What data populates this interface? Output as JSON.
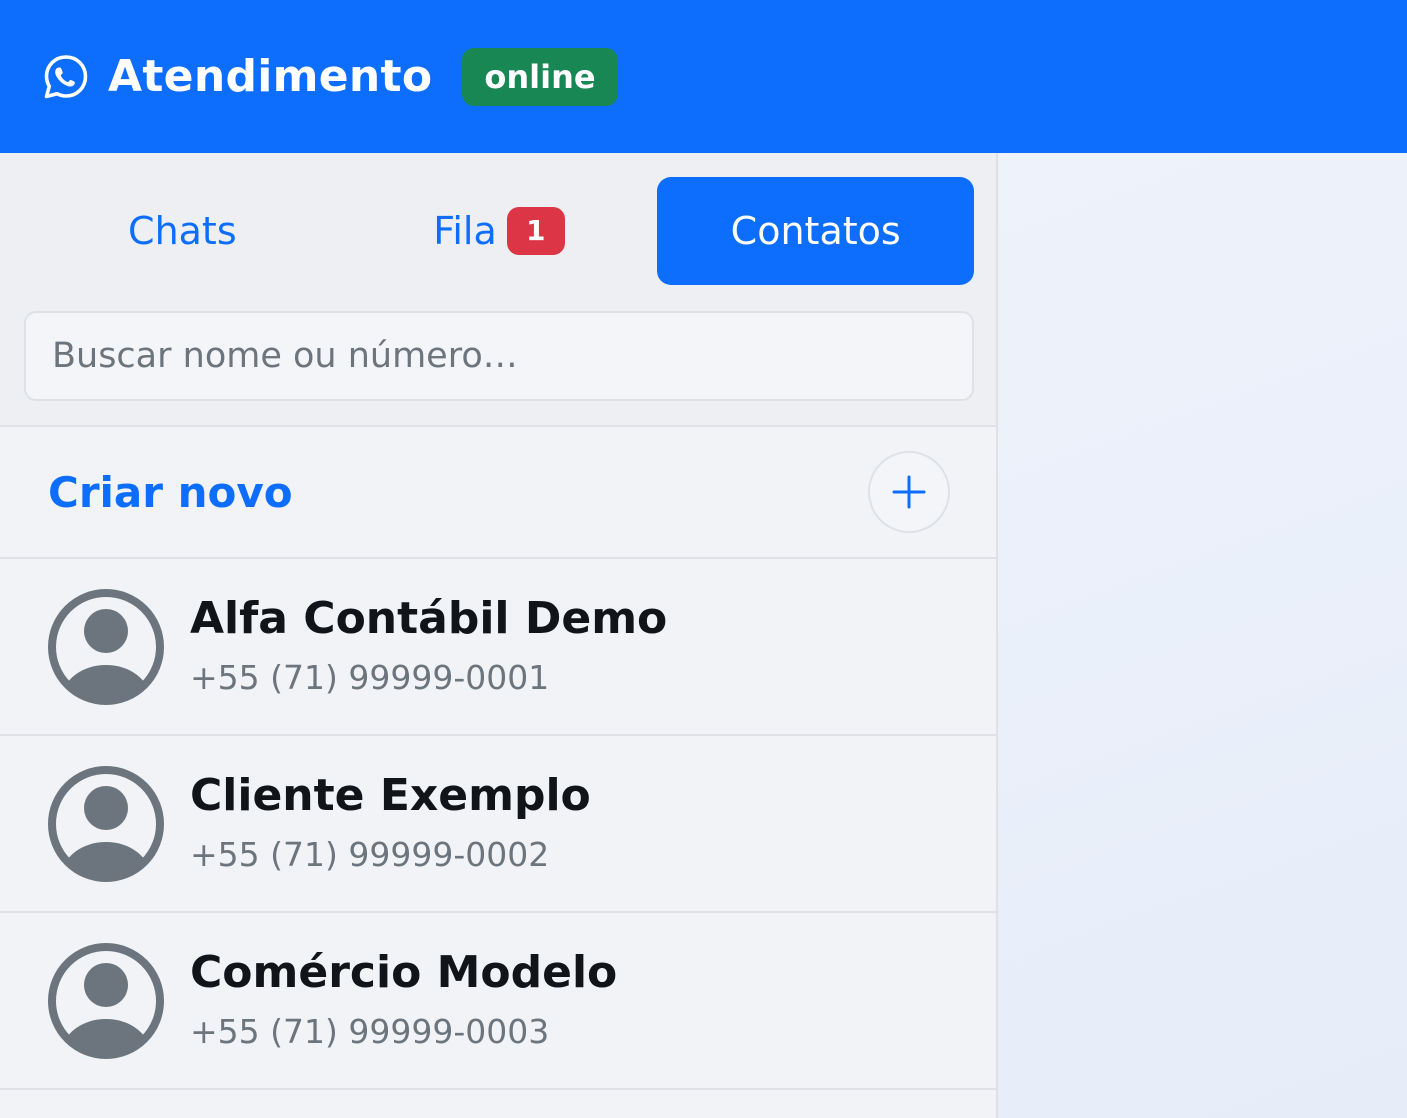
{
  "header": {
    "title": "Atendimento",
    "status": "online",
    "icon": "whatsapp-icon",
    "bg_color": "#0d6efd",
    "status_color": "#198754"
  },
  "tabs": [
    {
      "label": "Chats",
      "active": false
    },
    {
      "label": "Fila",
      "badge": "1",
      "active": false
    },
    {
      "label": "Contatos",
      "active": true
    }
  ],
  "search": {
    "placeholder": "Buscar nome ou número…",
    "value": ""
  },
  "create": {
    "label": "Criar novo",
    "icon": "plus-icon"
  },
  "contacts": [
    {
      "name": "Alfa Contábil Demo",
      "phone": "+55 (71) 99999-0001"
    },
    {
      "name": "Cliente Exemplo",
      "phone": "+55 (71) 99999-0002"
    },
    {
      "name": "Comércio Modelo",
      "phone": "+55 (71) 99999-0003"
    }
  ]
}
